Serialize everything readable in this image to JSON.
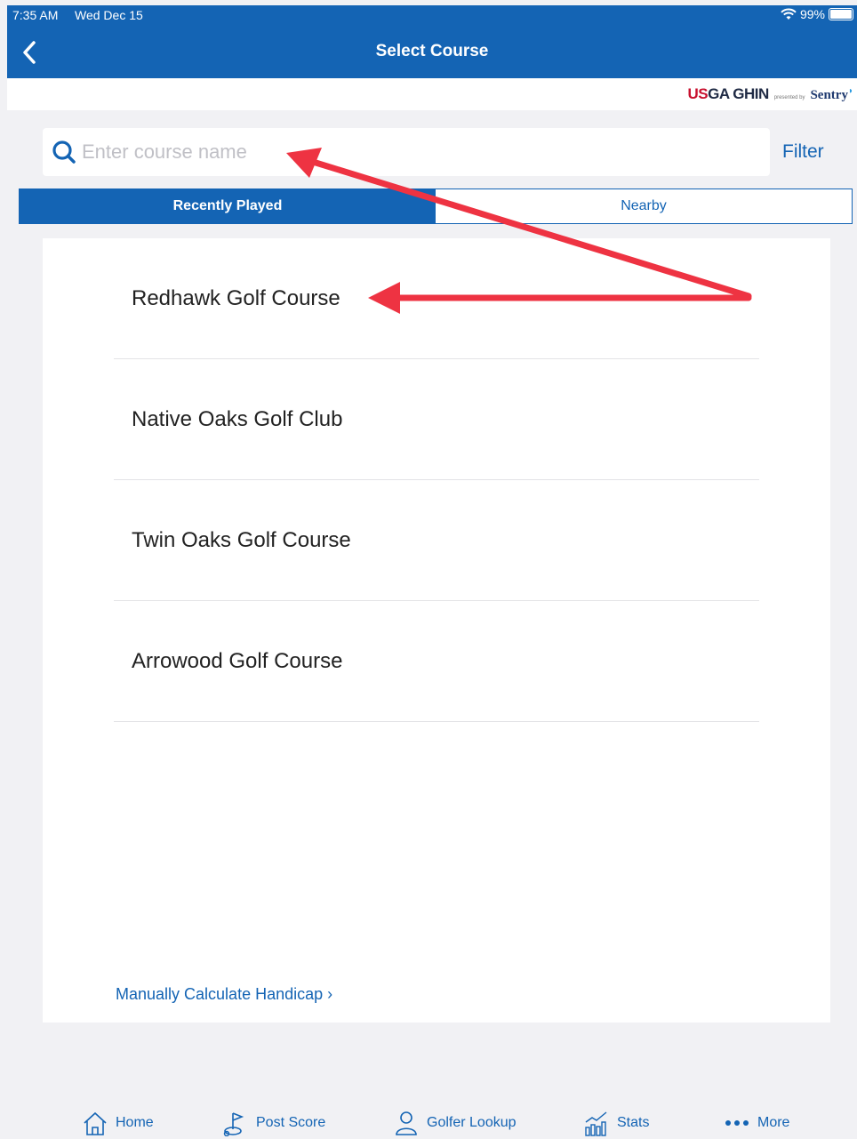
{
  "status_bar": {
    "time": "7:35 AM",
    "date": "Wed Dec 15",
    "battery": "99%"
  },
  "nav": {
    "title": "Select Course"
  },
  "brand": {
    "usga_prefix": "US",
    "usga_suffix": "GA",
    "ghin": "GHIN",
    "presented_by": "presented by",
    "sentry": "Sentry"
  },
  "search": {
    "placeholder": "Enter course name",
    "value": ""
  },
  "filter_label": "Filter",
  "tabs": [
    {
      "label": "Recently Played",
      "active": true
    },
    {
      "label": "Nearby",
      "active": false
    }
  ],
  "courses": [
    {
      "name": "Redhawk Golf Course"
    },
    {
      "name": "Native Oaks Golf Club"
    },
    {
      "name": "Twin Oaks Golf Course"
    },
    {
      "name": "Arrowood Golf Course"
    }
  ],
  "manual_link": "Manually Calculate Handicap ›",
  "bottom_tabs": [
    {
      "label": "Home",
      "icon": "home-icon"
    },
    {
      "label": "Post Score",
      "icon": "post-score-icon"
    },
    {
      "label": "Golfer Lookup",
      "icon": "golfer-lookup-icon"
    },
    {
      "label": "Stats",
      "icon": "stats-icon"
    },
    {
      "label": "More",
      "icon": "more-icon"
    }
  ],
  "colors": {
    "primary": "#1464b4",
    "annotation": "#ee3342",
    "background": "#f1f1f4"
  }
}
